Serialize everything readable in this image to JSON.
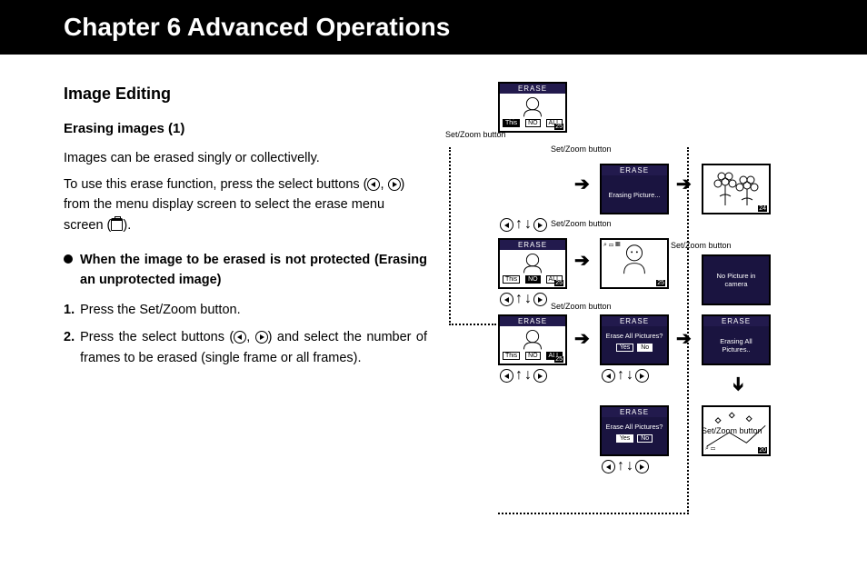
{
  "header": {
    "title": "Chapter 6   Advanced Operations"
  },
  "left": {
    "section": "Image Editing",
    "subsection": "Erasing images (1)",
    "p1": "Images can be erased singly or collectivelly.",
    "p2a": "To use this erase function, press the select buttons (",
    "p2b": ", ",
    "p2c": ") from the menu display screen to select the erase menu screen (",
    "p2d": ").",
    "bullet": "When the image to be erased is not protected (Erasing an unprotected image)",
    "step1_num": "1.",
    "step1": "Press the Set/Zoom button.",
    "step2_num": "2.",
    "step2a": "Press the select buttons (",
    "step2b": ", ",
    "step2c": ") and select the number of frames to be erased (single frame or all frames)."
  },
  "diagram": {
    "erase_title": "ERASE",
    "opt_this": "This",
    "opt_no": "NO",
    "opt_all": "ALL",
    "msg_erasing": "Erasing Picture...",
    "msg_nopic": "No Picture in camera",
    "msg_eraseall_q": "Erase All Pictures?",
    "msg_erasing_all": "Erasing All Pictures..",
    "yes": "Yes",
    "no": "No",
    "setzoom": "Set/Zoom button",
    "frame25": "25",
    "frame24": "24",
    "frame20": "20"
  }
}
